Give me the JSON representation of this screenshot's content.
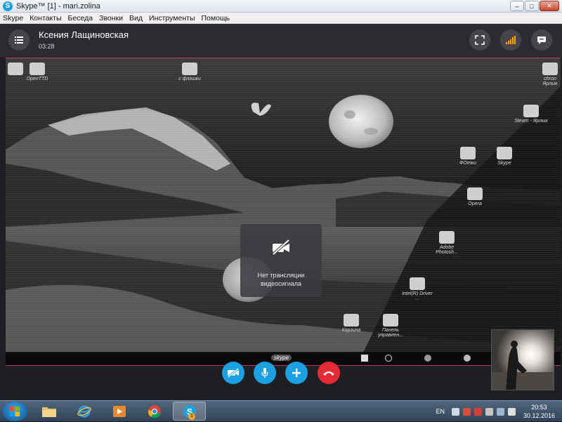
{
  "window": {
    "title": "Skype™ [1] - mari.zolina",
    "controls": {
      "minimize": "–",
      "maximize": "□",
      "close": "✕"
    }
  },
  "menu": [
    "Skype",
    "Контакты",
    "Беседа",
    "Звонки",
    "Вид",
    "Инструменты",
    "Помощь"
  ],
  "call": {
    "contact_name": "Ксения Лащиновская",
    "duration": "03:28"
  },
  "remote_screen": {
    "desktop_icons": [
      {
        "label": "OpenTTD"
      },
      {
        "label": "с флэшки"
      },
      {
        "label": "chron Ярлык"
      },
      {
        "label": "Steam - Ярлык"
      },
      {
        "label": "ФОтки"
      },
      {
        "label": "Skype"
      },
      {
        "label": "Opera"
      },
      {
        "label": "Adobe Photosh..."
      },
      {
        "label": "Intel(R) Driver ..."
      },
      {
        "label": "Корзина"
      },
      {
        "label": "Панель управлен..."
      }
    ],
    "taskbar_badge": "skype"
  },
  "no_video_notice": {
    "line1": "Нет трансляции",
    "line2": "видеосигнала"
  },
  "colors": {
    "accent": "#1ba1e2",
    "hangup": "#e32b37",
    "header_bg": "#2b2c30",
    "stage_bg": "#1e1f22",
    "video_border": "#c0356a"
  },
  "icons": {
    "menu": "list-icon",
    "fullscreen": "expand-icon",
    "quality": "signal-bars-icon",
    "chat": "chat-bubble-icon",
    "video_off": "camera-off-icon",
    "mic": "microphone-icon",
    "add": "plus-icon",
    "hangup": "phone-hangup-icon"
  },
  "taskbar": {
    "language": "EN",
    "time": "20:53",
    "date": "30.12.2016",
    "skype_badge": "1"
  }
}
